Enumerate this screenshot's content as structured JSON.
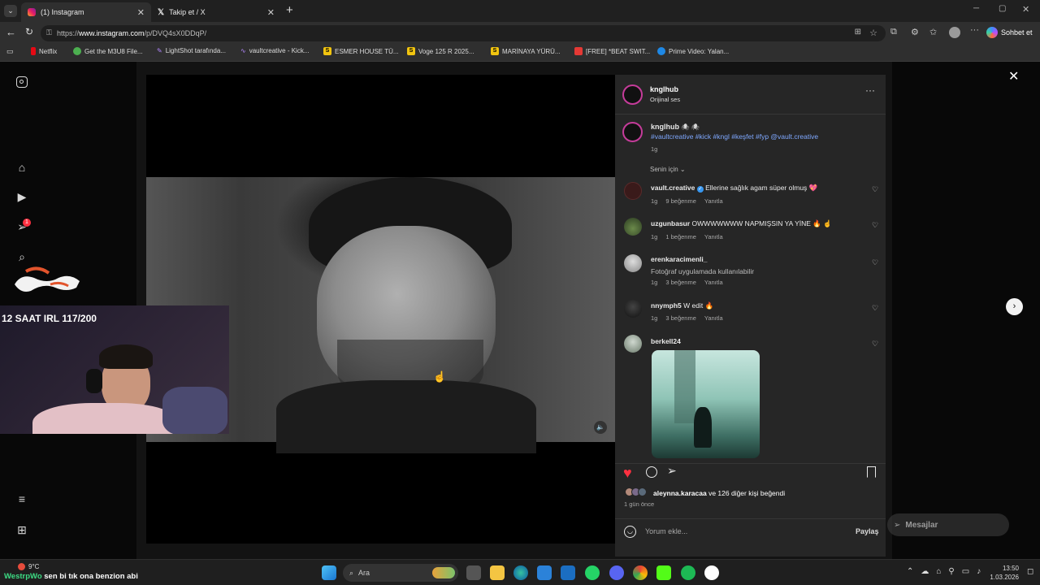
{
  "browser": {
    "tabs": [
      {
        "label": "(1) Instagram",
        "active": true
      },
      {
        "label": "Takip et / X",
        "active": false
      }
    ],
    "url_prefix": "https://",
    "url_host": "www.instagram.com",
    "url_path": "/p/DVQ4sX0DDqP/",
    "copilot_label": "Sohbet et",
    "bookmarks": [
      {
        "label": "Netflix",
        "color": "#e50914"
      },
      {
        "label": "Get the M3U8 File...",
        "color": "#4caf50"
      },
      {
        "label": "LightShot tarafında...",
        "color": "#8e44ad"
      },
      {
        "label": "vaultcreative - Kick...",
        "color": "#9b59b6"
      },
      {
        "label": "ESMER HOUSE TÜ...",
        "color": "#f1c40f"
      },
      {
        "label": "Voge 125 R 2025...",
        "color": "#f1c40f"
      },
      {
        "label": "MARİNAYA YÜRÜ...",
        "color": "#f1c40f"
      },
      {
        "label": "[FREE] *BEAT SWIT...",
        "color": "#e53935"
      },
      {
        "label": "Prime Video: Yalan...",
        "color": "#1e88e5"
      }
    ]
  },
  "post": {
    "author": "knglhub",
    "audio": "Orijinal ses",
    "caption_user": "knglhub",
    "caption_emoji": "🕷 🕷",
    "caption_tags": "#vaultcreative #kick #kngl #keşfet #fyp @vault.creative",
    "caption_age": "1g",
    "sort_label": "Senin için",
    "comments": [
      {
        "user": "vault.creative",
        "verified": true,
        "text": "Ellerine sağlık agam süper olmuş 💖",
        "age": "1g",
        "likes": "9 beğenme",
        "reply": "Yanıtla",
        "avatar": "#3a1a1a"
      },
      {
        "user": "uzgunbasur",
        "verified": false,
        "text": "OWWWWWWW NAPMIŞSIN YA YİNE 🔥 ☝",
        "age": "1g",
        "likes": "1 beğenme",
        "reply": "Yanıtla",
        "avatar": "#4a6a3a"
      },
      {
        "user": "erenkaracimenli_",
        "verified": false,
        "text": "Fotoğraf uygulamada kullanılabilir",
        "age": "1g",
        "likes": "3 beğenme",
        "reply": "Yanıtla",
        "avatar": "#bbbbbb",
        "text_muted": true
      },
      {
        "user": "nnymph5",
        "verified": false,
        "text": "W edit 🔥",
        "age": "1g",
        "likes": "3 beğenme",
        "reply": "Yanıtla",
        "avatar": "#222222"
      },
      {
        "user": "berkell24",
        "verified": false,
        "text": "",
        "age": "",
        "likes": "",
        "reply": "",
        "avatar": "#8a9a8a"
      }
    ],
    "likes_text": "aleynna.karacaa ve 126 diğer kişi beğendi",
    "likes_user": "aleynna.karacaa",
    "likes_rest": "ve 126 diğer kişi beğendi",
    "time_ago": "1 gün önce",
    "comment_placeholder": "Yorum ekle...",
    "share_label": "Paylaş",
    "messages_label": "Mesajlar",
    "notification_count": "1"
  },
  "stream": {
    "overlay_title": "12 SAAT IRL 117/200",
    "chat_user": "WestrpWo",
    "chat_text": "sen bi tık ona benzion abi"
  },
  "taskbar": {
    "weather": "9°C",
    "search_label": "Ara",
    "time": "13:50",
    "date": "1.03.2026"
  }
}
